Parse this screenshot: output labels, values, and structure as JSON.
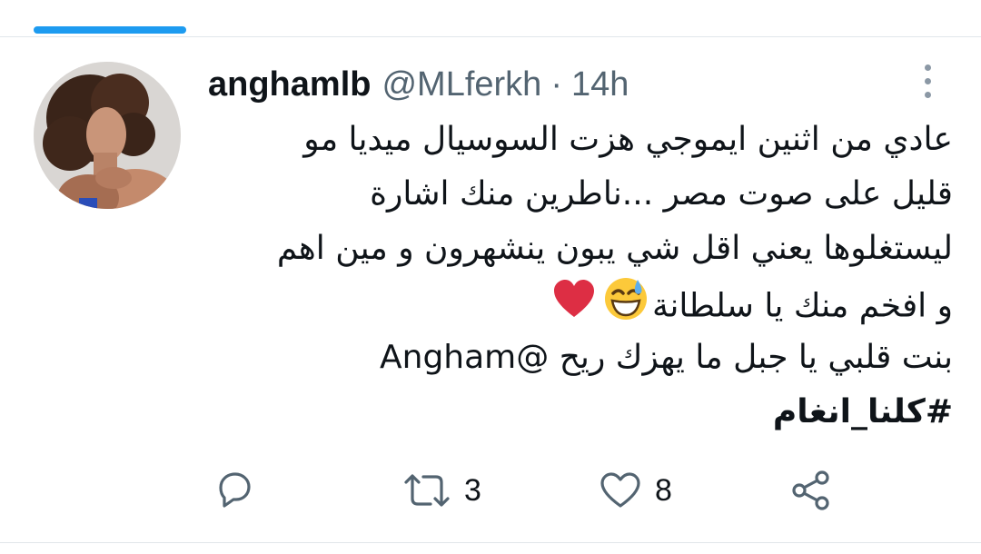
{
  "tweet": {
    "display_name": "anghamlb",
    "handle": "@MLferkh",
    "separator": "·",
    "time": "14h",
    "lines": [
      "عادي من اثنين ايموجي هزت السوسيال ميديا مو",
      "قليل على صوت مصر ...ناطرين منك اشارة",
      "ليستغلوها يعني اقل شي يبون ينشهرون و مين اهم",
      "و افخم منك يا سلطانة",
      "بنت قلبي يا جبل ما يهزك ريح @Angham"
    ],
    "hashtag": "#كلنا_انغام",
    "emojis": [
      "grinning-sweat-emoji",
      "red-heart-emoji"
    ]
  },
  "actions": {
    "reply": {
      "icon": "reply-icon"
    },
    "retweet": {
      "icon": "retweet-icon",
      "count": "3"
    },
    "like": {
      "icon": "heart-icon",
      "count": "8"
    },
    "share": {
      "icon": "share-icon"
    }
  },
  "colors": {
    "accent": "#1d9bf0",
    "text": "#0f1419",
    "secondary": "#536471",
    "icon": "#536471",
    "divider": "#e1e6ea",
    "heart_emoji": "#dd2e44",
    "smile_emoji": "#fcc93a"
  }
}
